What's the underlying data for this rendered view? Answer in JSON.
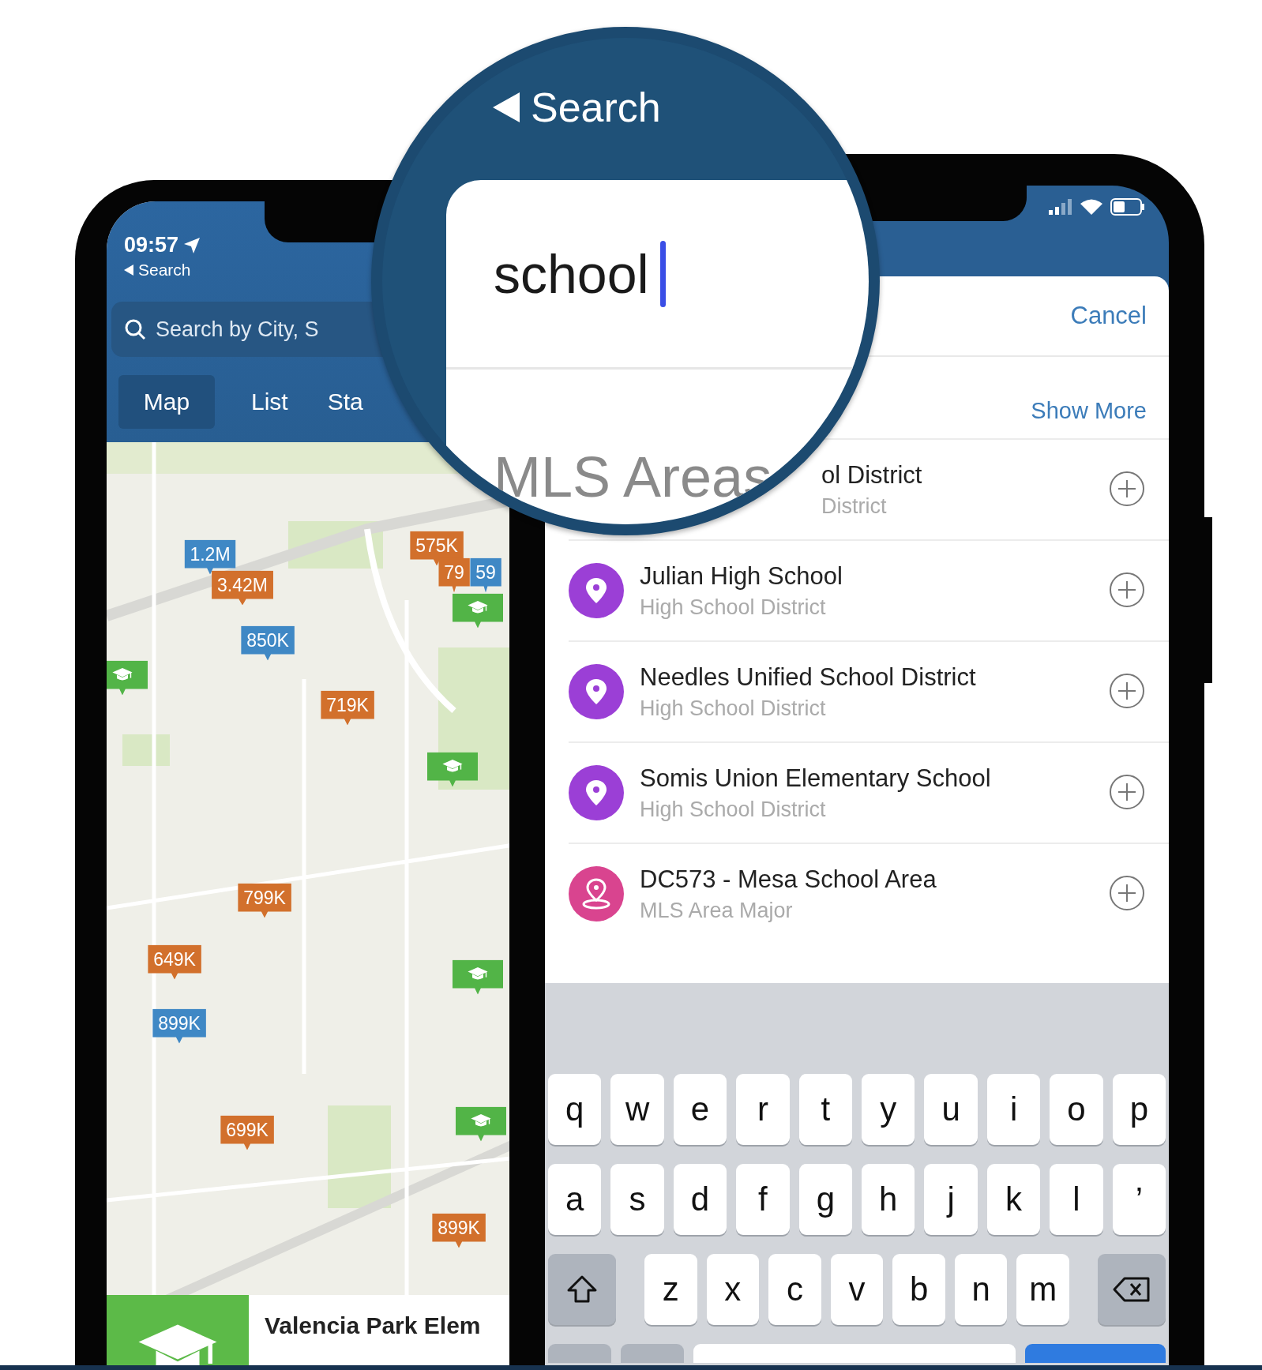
{
  "left_phone": {
    "status_bar": {
      "time": "09:57",
      "back_label": "Search"
    },
    "search": {
      "placeholder": "Search by City, S"
    },
    "tabs": [
      {
        "label": "Map",
        "selected": true
      },
      {
        "label": "List",
        "selected": false
      },
      {
        "label": "Sta",
        "selected": false
      }
    ],
    "map": {
      "pins": [
        {
          "kind": "price",
          "label": "1.2M",
          "color": "#3f88c5"
        },
        {
          "kind": "price",
          "label": "3.42M",
          "color": "#d2702c"
        },
        {
          "kind": "price",
          "label": "575K",
          "color": "#d2702c"
        },
        {
          "kind": "price",
          "label": "79",
          "color": "#d2702c"
        },
        {
          "kind": "price",
          "label": "59",
          "color": "#3f88c5"
        },
        {
          "kind": "school",
          "color": "#52b447"
        },
        {
          "kind": "price",
          "label": "850K",
          "color": "#3f88c5"
        },
        {
          "kind": "school",
          "color": "#52b447"
        },
        {
          "kind": "price",
          "label": "719K",
          "color": "#d2702c"
        },
        {
          "kind": "school",
          "color": "#52b447"
        },
        {
          "kind": "price",
          "label": "799K",
          "color": "#d2702c"
        },
        {
          "kind": "price",
          "label": "649K",
          "color": "#d2702c"
        },
        {
          "kind": "school",
          "color": "#52b447"
        },
        {
          "kind": "price",
          "label": "899K",
          "color": "#3f88c5"
        },
        {
          "kind": "school",
          "color": "#52b447"
        },
        {
          "kind": "price",
          "label": "699K",
          "color": "#d2702c"
        },
        {
          "kind": "price",
          "label": "899K",
          "color": "#d2702c"
        }
      ]
    },
    "card": {
      "title": "Valencia Park Elem"
    }
  },
  "magnifier": {
    "back_label": "Search",
    "query": "school",
    "section_title": "MLS Areas"
  },
  "right_phone": {
    "cancel": "Cancel",
    "show_more": "Show More",
    "results": [
      {
        "kind": "partial",
        "title": "ol District",
        "subtitle": "District"
      },
      {
        "kind": "school-district",
        "title": "Julian High School",
        "subtitle": "High School District",
        "color": "#9b3fd6"
      },
      {
        "kind": "school-district",
        "title": "Needles Unified School District",
        "subtitle": "High School District",
        "color": "#9b3fd6"
      },
      {
        "kind": "school-district",
        "title": "Somis Union Elementary School",
        "subtitle": "High School District",
        "color": "#9b3fd6"
      },
      {
        "kind": "mls-area",
        "title": "DC573 - Mesa School Area",
        "subtitle": "MLS Area Major",
        "color": "#d9448f"
      }
    ],
    "keyboard": {
      "rows": [
        {
          "kind": "letters",
          "keys": [
            "q",
            "w",
            "e",
            "r",
            "t",
            "y",
            "u",
            "i",
            "o",
            "p"
          ]
        },
        {
          "kind": "letters",
          "keys": [
            "a",
            "s",
            "d",
            "f",
            "g",
            "h",
            "j",
            "k",
            "l",
            "’"
          ]
        },
        {
          "kind": "shift-delete",
          "keys": [
            "z",
            "x",
            "c",
            "v",
            "b",
            "n",
            "m"
          ]
        },
        {
          "kind": "bottom",
          "keys": []
        }
      ]
    }
  }
}
